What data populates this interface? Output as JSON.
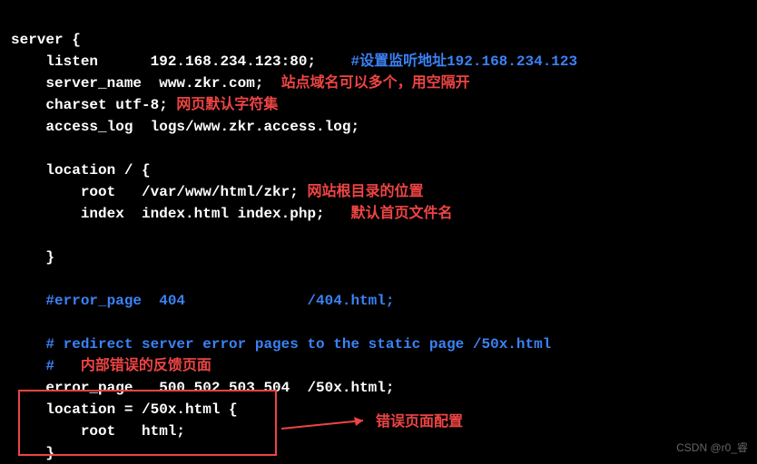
{
  "code": {
    "l1": "server {",
    "l2": "    listen      192.168.234.123:80;",
    "l2c": "    #设置监听地址192.168.234.123",
    "l3": "    server_name  www.zkr.com;",
    "l3c": "  站点域名可以多个，用空隔开",
    "l4": "    charset utf-8;",
    "l4c": " 网页默认字符集",
    "l5": "    access_log  logs/www.zkr.access.log;",
    "l6": "",
    "l7": "    location / {",
    "l8": "        root   /var/www/html/zkr;",
    "l8c": " 网站根目录的位置",
    "l9": "        index  index.html index.php;",
    "l9c": "   默认首页文件名",
    "l10": "",
    "l11": "    }",
    "l12": "",
    "l13": "    #error_page  404              /404.html;",
    "l14": "",
    "l15": "    # redirect server error pages to the static page /50x.html",
    "l16a": "    #",
    "l16b": "   内部错误的反馈页面",
    "l17": "    error_page   500 502 503 504  /50x.html;",
    "l18": "    location = /50x.html {",
    "l19": "        root   html;",
    "l20": "    }"
  },
  "annotations": {
    "error_box_label": "错误页面配置"
  },
  "watermark": "CSDN @r0_睿"
}
